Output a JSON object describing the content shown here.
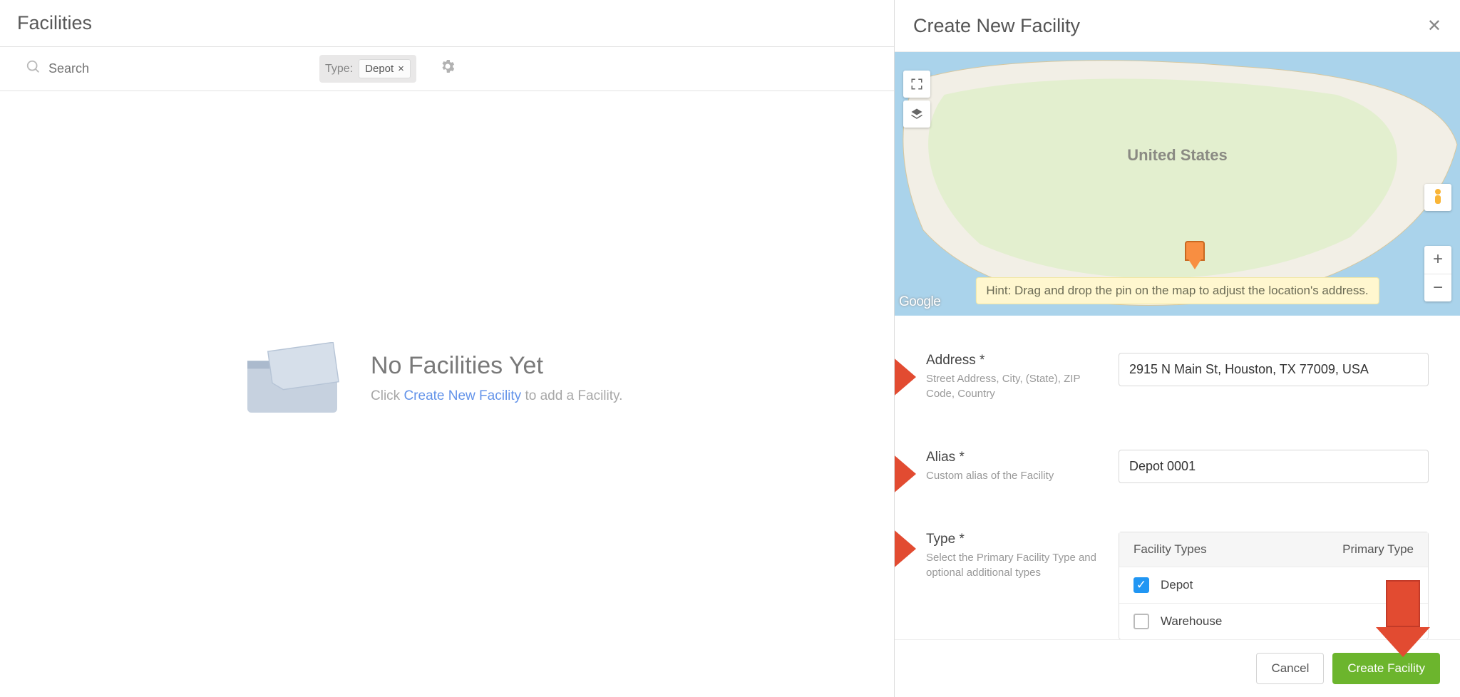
{
  "page": {
    "title": "Facilities",
    "create_btn": "Create New Facility",
    "search_placeholder": "Search",
    "filter_label": "Type:",
    "filter_value": "Depot",
    "empty_title": "No Facilities Yet",
    "empty_desc_pre": "Click",
    "empty_desc_link": "Create New Facility",
    "empty_desc_post": "to add a Facility."
  },
  "panel": {
    "title": "Create New Facility",
    "hint": "Hint: Drag and drop the pin on the map to adjust the location's address.",
    "map_center_label": "United States",
    "google_label": "Google",
    "zoom_in": "+",
    "zoom_out": "−",
    "address": {
      "label": "Address *",
      "desc": "Street Address, City, (State), ZIP Code, Country",
      "value": "2915 N Main St, Houston, TX 77009, USA"
    },
    "alias": {
      "label": "Alias *",
      "desc": "Custom alias of the Facility",
      "value": "Depot 0001"
    },
    "type": {
      "label": "Type *",
      "desc": "Select the Primary Facility Type and optional additional types",
      "col1": "Facility Types",
      "col2": "Primary Type",
      "rows": [
        {
          "label": "Depot",
          "checked": true
        },
        {
          "label": "Warehouse",
          "checked": false
        }
      ]
    },
    "footer": {
      "cancel": "Cancel",
      "create": "Create Facility"
    }
  }
}
